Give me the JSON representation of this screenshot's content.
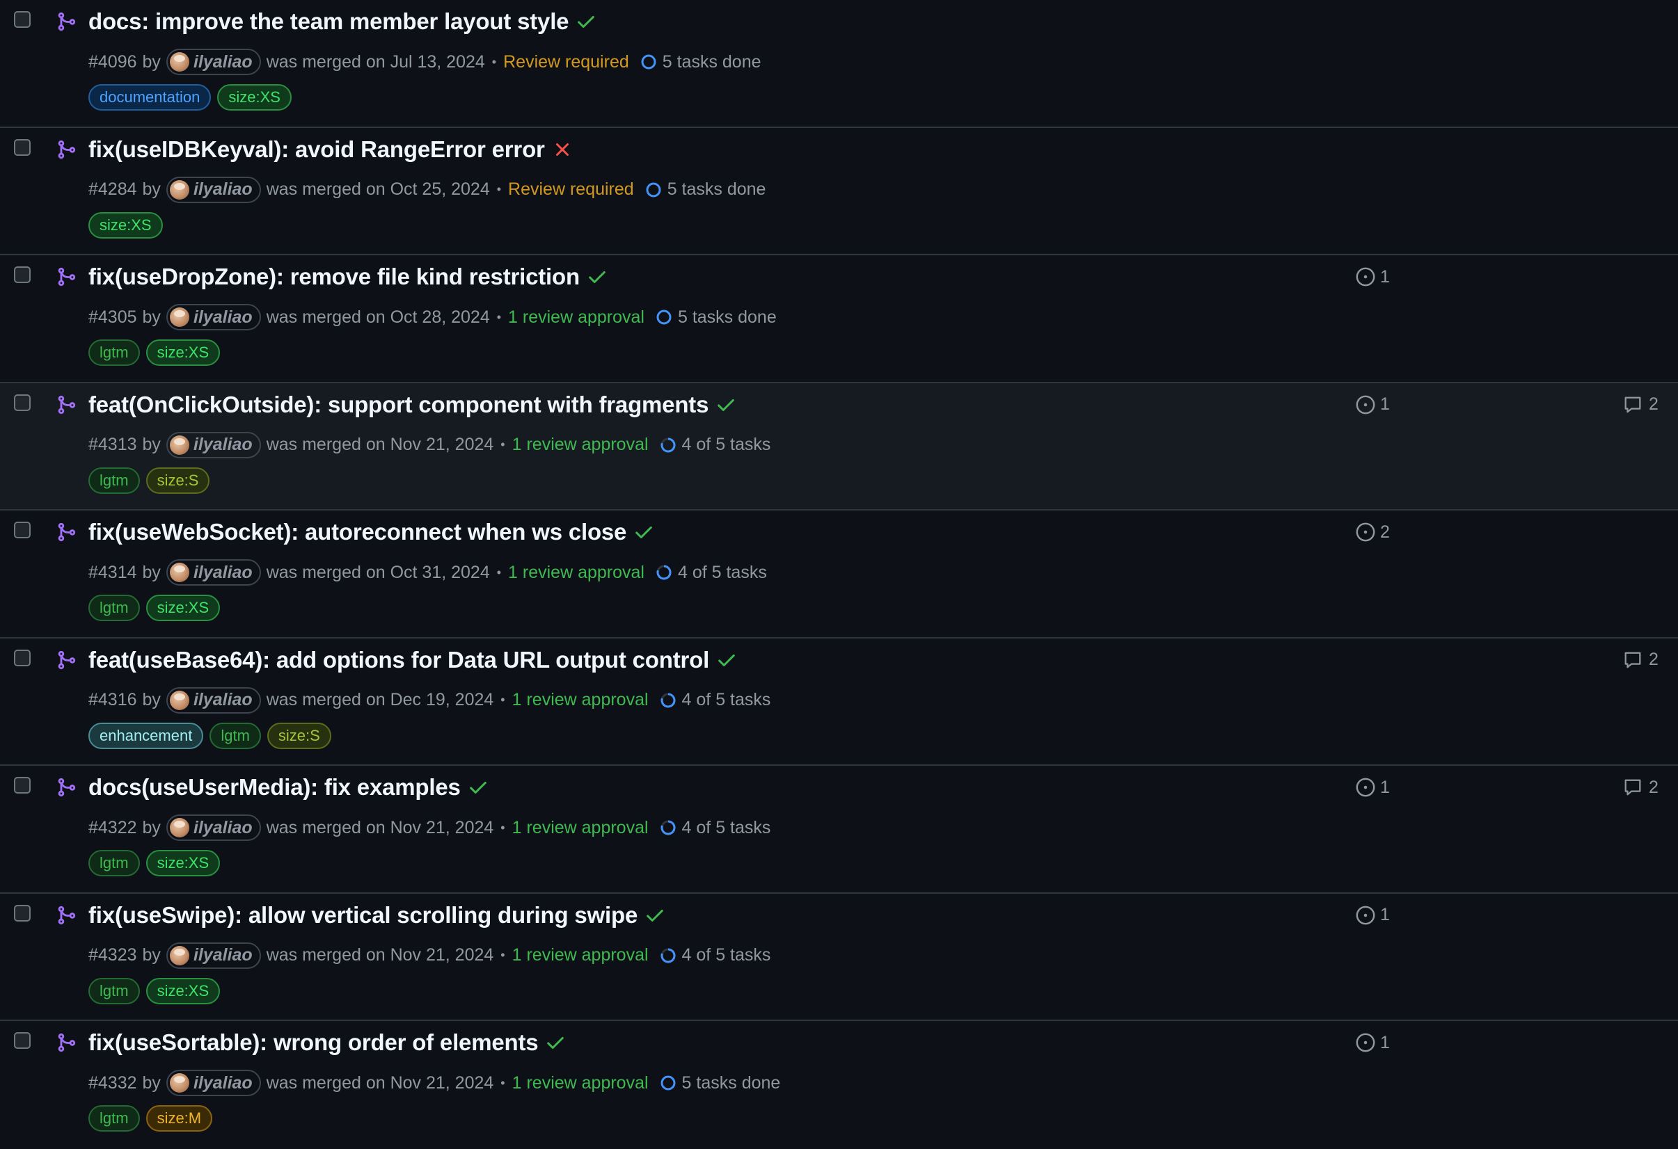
{
  "colors": {
    "background": "#0d1117",
    "title": "#f0f6fc",
    "muted": "#9198a1",
    "merged_icon": "#a371f7",
    "check": "#3fb950",
    "fail": "#f85149",
    "review_required": "#d29922",
    "review_approval": "#3fb950"
  },
  "pull_requests": [
    {
      "title": "docs: improve the team member layout style",
      "status": "success",
      "number": "#4096",
      "by": "by",
      "author": "ilyaliao",
      "merged_text": "was merged on Jul 13, 2024",
      "review_text": "Review required",
      "review_kind": "required",
      "tasks_text": "5 tasks done",
      "tasks_complete": true,
      "labels": [
        {
          "name": "documentation",
          "kind": "documentation"
        },
        {
          "name": "size:XS",
          "kind": "size-xs"
        }
      ],
      "linked_issues": "",
      "comments": ""
    },
    {
      "title": "fix(useIDBKeyval): avoid RangeError error",
      "status": "failure",
      "number": "#4284",
      "by": "by",
      "author": "ilyaliao",
      "merged_text": "was merged on Oct 25, 2024",
      "review_text": "Review required",
      "review_kind": "required",
      "tasks_text": "5 tasks done",
      "tasks_complete": true,
      "labels": [
        {
          "name": "size:XS",
          "kind": "size-xs"
        }
      ],
      "linked_issues": "",
      "comments": ""
    },
    {
      "title": "fix(useDropZone): remove file kind restriction",
      "status": "success",
      "number": "#4305",
      "by": "by",
      "author": "ilyaliao",
      "merged_text": "was merged on Oct 28, 2024",
      "review_text": "1 review approval",
      "review_kind": "approval",
      "tasks_text": "5 tasks done",
      "tasks_complete": true,
      "labels": [
        {
          "name": "lgtm",
          "kind": "lgtm"
        },
        {
          "name": "size:XS",
          "kind": "size-xs"
        }
      ],
      "linked_issues": "1",
      "comments": ""
    },
    {
      "title": "feat(OnClickOutside): support component with fragments",
      "status": "success",
      "number": "#4313",
      "by": "by",
      "author": "ilyaliao",
      "merged_text": "was merged on Nov 21, 2024",
      "review_text": "1 review approval",
      "review_kind": "approval",
      "tasks_text": "4 of 5 tasks",
      "tasks_complete": false,
      "labels": [
        {
          "name": "lgtm",
          "kind": "lgtm"
        },
        {
          "name": "size:S",
          "kind": "size-s"
        }
      ],
      "linked_issues": "1",
      "comments": "2",
      "hover": true
    },
    {
      "title": "fix(useWebSocket): autoreconnect when ws close",
      "status": "success",
      "number": "#4314",
      "by": "by",
      "author": "ilyaliao",
      "merged_text": "was merged on Oct 31, 2024",
      "review_text": "1 review approval",
      "review_kind": "approval",
      "tasks_text": "4 of 5 tasks",
      "tasks_complete": false,
      "labels": [
        {
          "name": "lgtm",
          "kind": "lgtm"
        },
        {
          "name": "size:XS",
          "kind": "size-xs"
        }
      ],
      "linked_issues": "2",
      "comments": ""
    },
    {
      "title": "feat(useBase64): add options for Data URL output control",
      "status": "success",
      "number": "#4316",
      "by": "by",
      "author": "ilyaliao",
      "merged_text": "was merged on Dec 19, 2024",
      "review_text": "1 review approval",
      "review_kind": "approval",
      "tasks_text": "4 of 5 tasks",
      "tasks_complete": false,
      "labels": [
        {
          "name": "enhancement",
          "kind": "enhancement"
        },
        {
          "name": "lgtm",
          "kind": "lgtm"
        },
        {
          "name": "size:S",
          "kind": "size-s"
        }
      ],
      "linked_issues": "",
      "comments": "2"
    },
    {
      "title": "docs(useUserMedia): fix examples",
      "status": "success",
      "number": "#4322",
      "by": "by",
      "author": "ilyaliao",
      "merged_text": "was merged on Nov 21, 2024",
      "review_text": "1 review approval",
      "review_kind": "approval",
      "tasks_text": "4 of 5 tasks",
      "tasks_complete": false,
      "labels": [
        {
          "name": "lgtm",
          "kind": "lgtm"
        },
        {
          "name": "size:XS",
          "kind": "size-xs"
        }
      ],
      "linked_issues": "1",
      "comments": "2"
    },
    {
      "title": "fix(useSwipe): allow vertical scrolling during swipe",
      "status": "success",
      "number": "#4323",
      "by": "by",
      "author": "ilyaliao",
      "merged_text": "was merged on Nov 21, 2024",
      "review_text": "1 review approval",
      "review_kind": "approval",
      "tasks_text": "4 of 5 tasks",
      "tasks_complete": false,
      "labels": [
        {
          "name": "lgtm",
          "kind": "lgtm"
        },
        {
          "name": "size:XS",
          "kind": "size-xs"
        }
      ],
      "linked_issues": "1",
      "comments": ""
    },
    {
      "title": "fix(useSortable): wrong order of elements",
      "status": "success",
      "number": "#4332",
      "by": "by",
      "author": "ilyaliao",
      "merged_text": "was merged on Nov 21, 2024",
      "review_text": "1 review approval",
      "review_kind": "approval",
      "tasks_text": "5 tasks done",
      "tasks_complete": true,
      "labels": [
        {
          "name": "lgtm",
          "kind": "lgtm"
        },
        {
          "name": "size:M",
          "kind": "size-m"
        }
      ],
      "linked_issues": "1",
      "comments": ""
    }
  ]
}
